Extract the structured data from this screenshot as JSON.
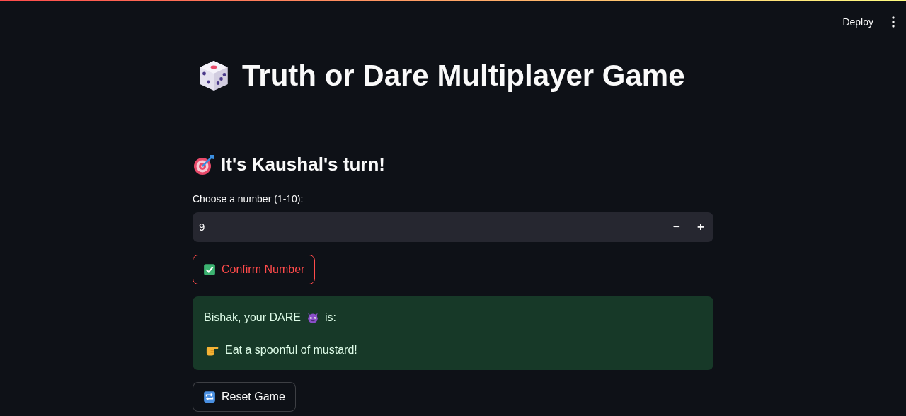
{
  "header": {
    "deploy_label": "Deploy"
  },
  "title": "Truth or Dare Multiplayer Game",
  "turn_heading": "It's Kaushal's turn!",
  "number_input": {
    "label": "Choose a number (1-10):",
    "value": "9",
    "decrement": "−",
    "increment": "+"
  },
  "confirm_button": {
    "label": "Confirm Number",
    "focused": true
  },
  "result": {
    "intro_before": "Bishak, your DARE",
    "intro_after": "is:",
    "dare": "Eat a spoonful of mustard!"
  },
  "reset_button": {
    "label": "Reset Game",
    "focused": false
  }
}
